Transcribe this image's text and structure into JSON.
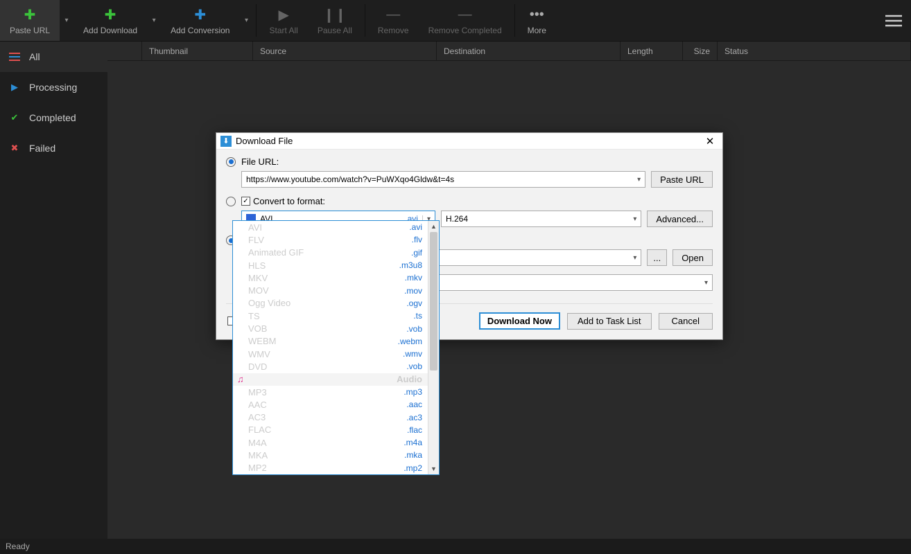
{
  "toolbar": {
    "paste_url": "Paste URL",
    "add_download": "Add Download",
    "add_conversion": "Add Conversion",
    "start_all": "Start All",
    "pause_all": "Pause All",
    "remove": "Remove",
    "remove_completed": "Remove Completed",
    "more": "More"
  },
  "sidebar": {
    "all": "All",
    "processing": "Processing",
    "completed": "Completed",
    "failed": "Failed"
  },
  "columns": {
    "thumbnail": "Thumbnail",
    "source": "Source",
    "destination": "Destination",
    "length": "Length",
    "size": "Size",
    "status": "Status"
  },
  "status_bar": "Ready",
  "dialog": {
    "title": "Download File",
    "file_url_label": "File URL:",
    "url_value": "https://www.youtube.com/watch?v=PuWXqo4Gldw&t=4s",
    "paste_btn": "Paste URL",
    "convert_label": "Convert to format:",
    "format_sel_name": "AVI",
    "format_sel_ext": ".avi",
    "codec_sel": "H.264",
    "advanced_btn": "Advanced...",
    "browse_btn": "...",
    "open_btn": "Open",
    "download_now_btn": "Download Now",
    "add_task_btn": "Add to Task List",
    "cancel_btn": "Cancel"
  },
  "dropdown": {
    "video": [
      {
        "name": "AVI",
        "ext": ".avi"
      },
      {
        "name": "FLV",
        "ext": ".flv"
      },
      {
        "name": "Animated GIF",
        "ext": ".gif"
      },
      {
        "name": "HLS",
        "ext": ".m3u8"
      },
      {
        "name": "MKV",
        "ext": ".mkv"
      },
      {
        "name": "MOV",
        "ext": ".mov"
      },
      {
        "name": "Ogg Video",
        "ext": ".ogv"
      },
      {
        "name": "TS",
        "ext": ".ts"
      },
      {
        "name": "VOB",
        "ext": ".vob"
      },
      {
        "name": "WEBM",
        "ext": ".webm"
      },
      {
        "name": "WMV",
        "ext": ".wmv"
      },
      {
        "name": "DVD",
        "ext": ".vob"
      }
    ],
    "audio_header": "Audio",
    "audio": [
      {
        "name": "MP3",
        "ext": ".mp3"
      },
      {
        "name": "AAC",
        "ext": ".aac"
      },
      {
        "name": "AC3",
        "ext": ".ac3"
      },
      {
        "name": "FLAC",
        "ext": ".flac"
      },
      {
        "name": "M4A",
        "ext": ".m4a"
      },
      {
        "name": "MKA",
        "ext": ".mka"
      },
      {
        "name": "MP2",
        "ext": ".mp2"
      }
    ]
  }
}
